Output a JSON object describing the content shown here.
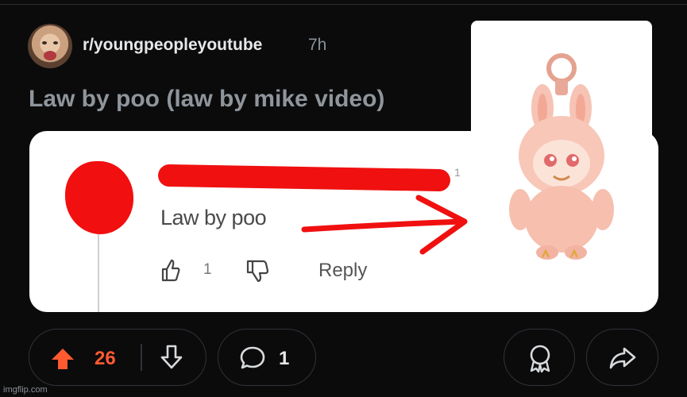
{
  "post": {
    "subreddit": "r/youngpeopleyoutube",
    "age": "7h",
    "title": "Law by poo (law by mike video)"
  },
  "media": {
    "comment_text": "Law by poo",
    "comment_timestamp": "1",
    "likes": "1",
    "reply_label": "Reply"
  },
  "actions": {
    "score": "26",
    "comment_count": "1"
  },
  "watermark": "imgflip.com",
  "colors": {
    "upvote": "#ff5a30",
    "background": "#0b0b0c",
    "scribble_red": "#f01010"
  }
}
